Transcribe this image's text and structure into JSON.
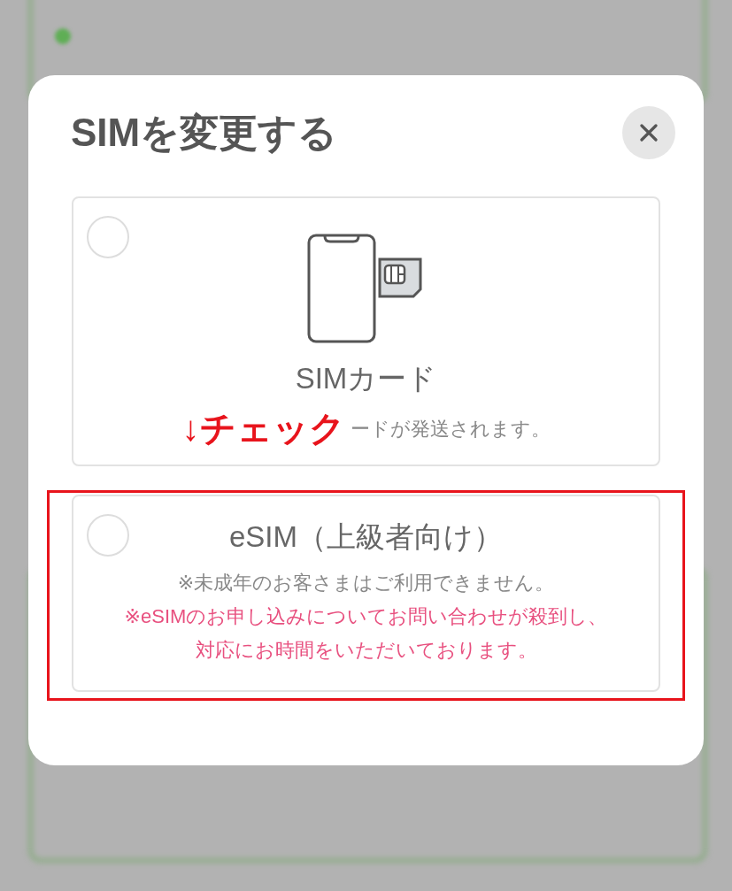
{
  "modal": {
    "title": "SIMを変更する",
    "options": [
      {
        "kind": "sim_card",
        "title": "SIMカード",
        "annotation": "↓チェック",
        "notes": [
          {
            "text": "ードが発送されます。",
            "kind": "muted"
          }
        ],
        "selected": false,
        "highlighted": false
      },
      {
        "kind": "esim",
        "title": "eSIM（上級者向け）",
        "notes": [
          {
            "text": "※未成年のお客さまはご利用できません。",
            "kind": "muted"
          },
          {
            "text": "※eSIMのお申し込みについてお問い合わせが殺到し、対応にお時間をいただいております。",
            "kind": "warning"
          }
        ],
        "selected": false,
        "highlighted": true
      }
    ]
  }
}
